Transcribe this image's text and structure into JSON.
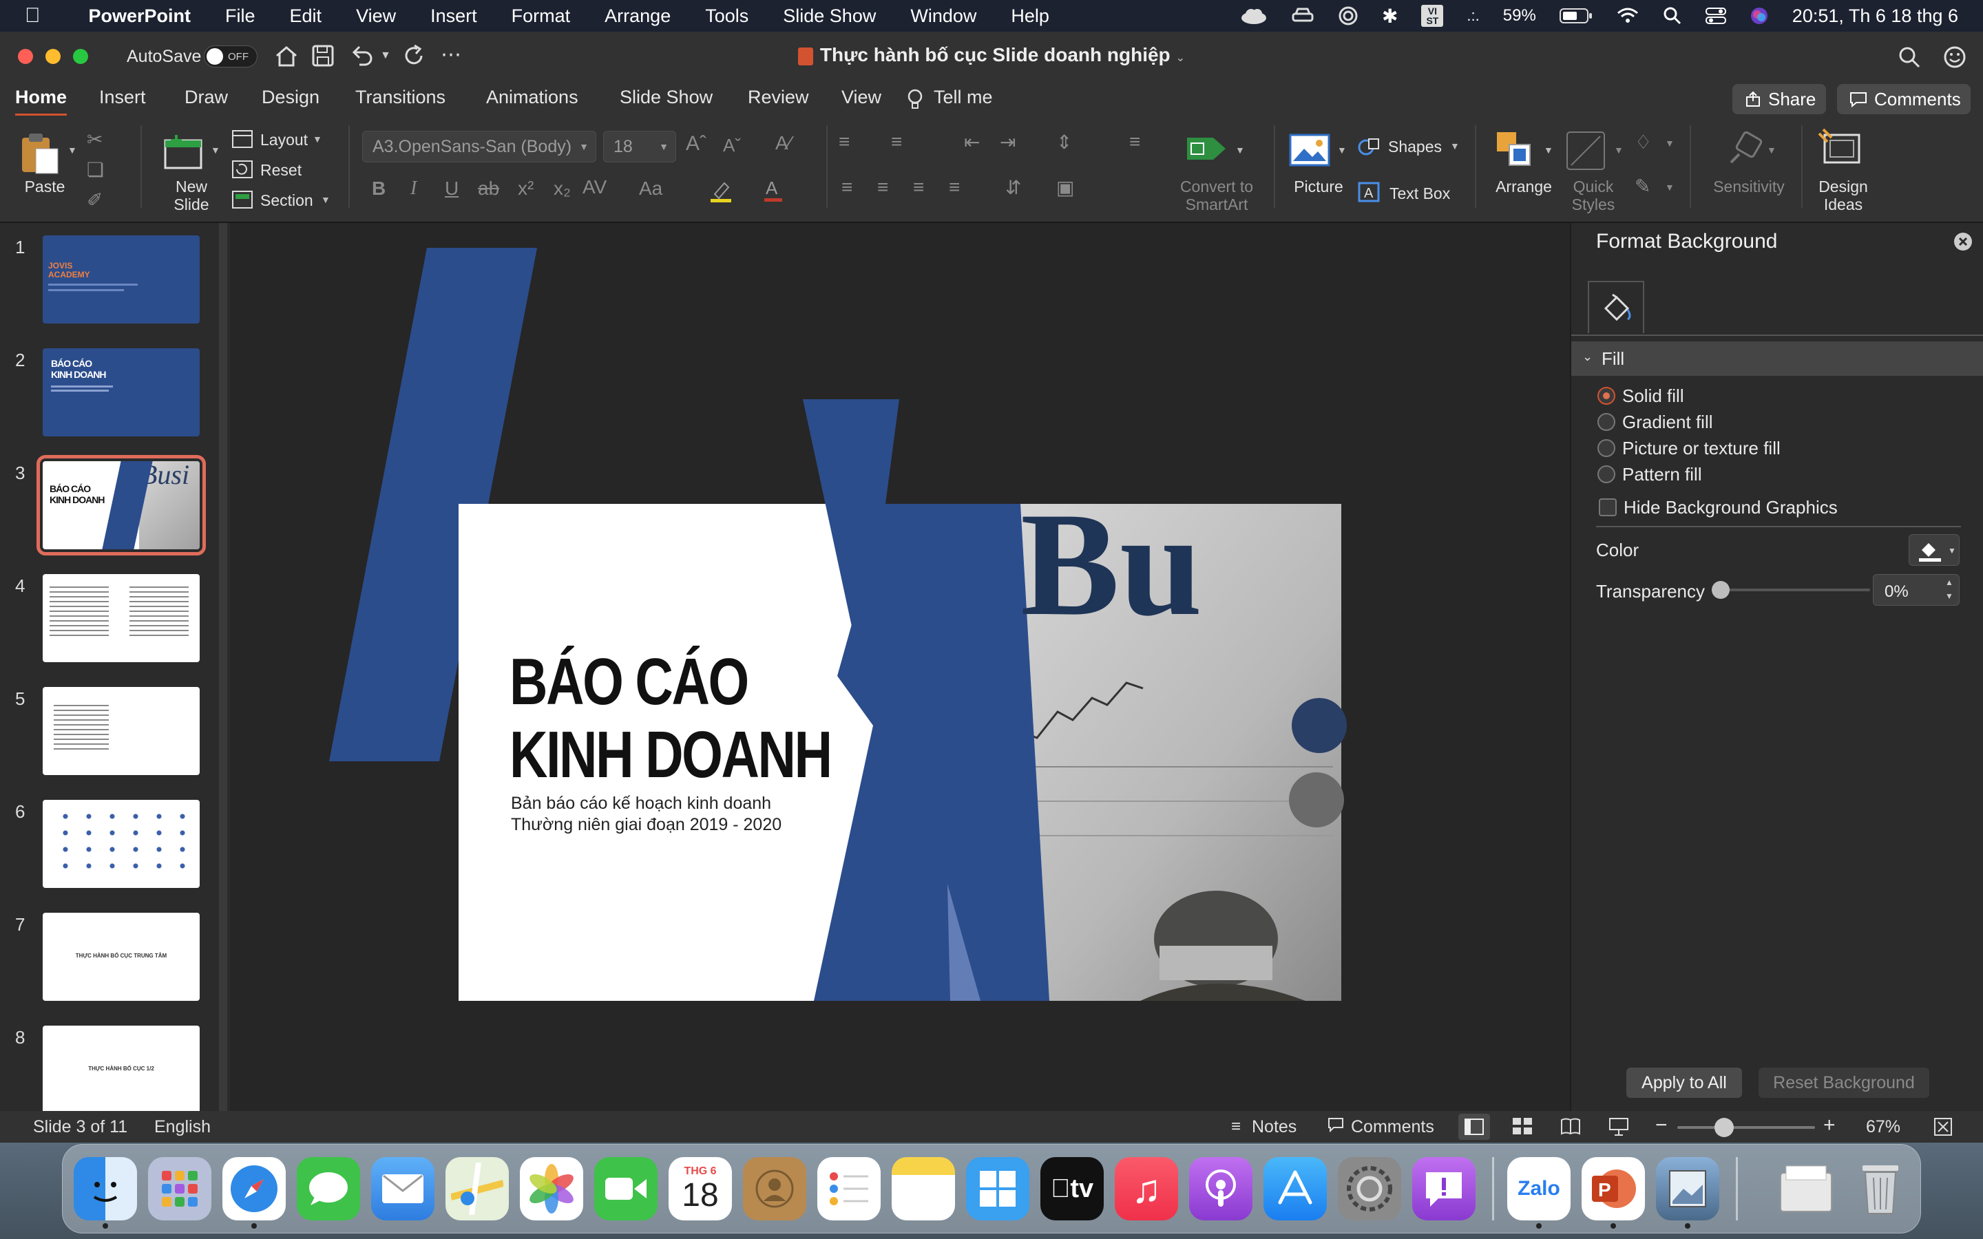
{
  "menubar": {
    "app_name": "PowerPoint",
    "items": [
      "File",
      "Edit",
      "View",
      "Insert",
      "Format",
      "Arrange",
      "Tools",
      "Slide Show",
      "Window",
      "Help"
    ],
    "battery": "59%",
    "datetime": "20:51, Th 6 18 thg 6",
    "input_method": "VI ST"
  },
  "titlebar": {
    "autosave_label": "AutoSave",
    "autosave_state": "OFF",
    "document_title": "Thực hành bố cục Slide doanh nghiệp"
  },
  "ribbon_tabs": {
    "tabs": [
      "Home",
      "Insert",
      "Draw",
      "Design",
      "Transitions",
      "Animations",
      "Slide Show",
      "Review",
      "View"
    ],
    "tell_me": "Tell me",
    "share": "Share",
    "comments": "Comments"
  },
  "ribbon": {
    "paste": "Paste",
    "new_slide_1": "New",
    "new_slide_2": "Slide",
    "layout": "Layout",
    "reset": "Reset",
    "section": "Section",
    "font_name": "A3.OpenSans-San (Body)",
    "font_size": "18",
    "convert_1": "Convert to",
    "convert_2": "SmartArt",
    "picture": "Picture",
    "shapes": "Shapes",
    "text_box": "Text Box",
    "arrange": "Arrange",
    "quick_styles_1": "Quick",
    "quick_styles_2": "Styles",
    "sensitivity": "Sensitivity",
    "design_ideas_1": "Design",
    "design_ideas_2": "Ideas"
  },
  "thumbnails": {
    "numbers": [
      "1",
      "2",
      "3",
      "4",
      "5",
      "6",
      "7",
      "8"
    ],
    "t1_title_1": "JOVIS",
    "t1_title_2": "ACADEMY",
    "t2_title_1": "BÁO CÁO",
    "t2_title_2": "KINH DOANH",
    "t7_text": "THỰC HÀNH BỐ CỤC TRUNG TÂM",
    "t8_text": "THỰC HÀNH BỐ CỤC 1/2"
  },
  "slide": {
    "title_1": "BÁO CÁO",
    "title_2": "KINH DOANH",
    "subtitle_1": "Bản báo cáo kế hoạch kinh doanh",
    "subtitle_2": "Thường niên giai đoạn 2019 - 2020",
    "photo_word": "Busi"
  },
  "format_background": {
    "title": "Format Background",
    "section": "Fill",
    "options": [
      "Solid fill",
      "Gradient fill",
      "Picture or texture fill",
      "Pattern fill"
    ],
    "selected": "Solid fill",
    "hide_graphics": "Hide Background Graphics",
    "color_label": "Color",
    "transparency_label": "Transparency",
    "transparency_value": "0%",
    "transparency": 0,
    "apply_all": "Apply to All",
    "reset_bg": "Reset Background"
  },
  "status": {
    "slide_info": "Slide 3 of 11",
    "language": "English",
    "notes": "Notes",
    "comments": "Comments",
    "zoom": "67%"
  },
  "dock": {
    "calendar_month": "THG 6",
    "calendar_day": "18",
    "appletv": "tv",
    "zalo": "Zalo"
  },
  "colors": {
    "accent": "#d35230",
    "slide_blue": "#2c4d8c",
    "ribbon_bg": "#323232"
  }
}
